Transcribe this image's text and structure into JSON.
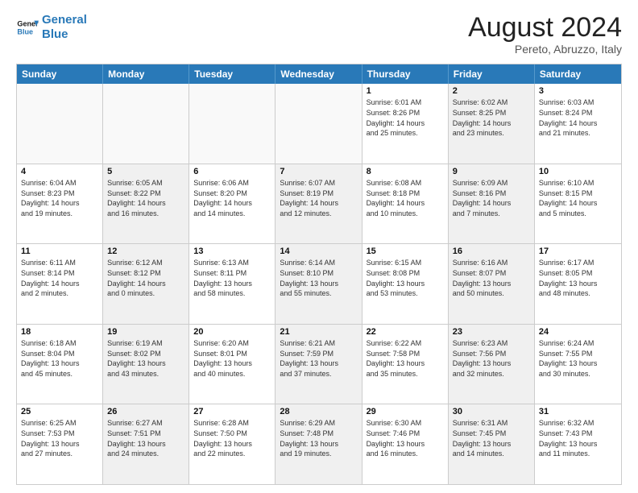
{
  "header": {
    "logo_line1": "General",
    "logo_line2": "Blue",
    "main_title": "August 2024",
    "subtitle": "Pereto, Abruzzo, Italy"
  },
  "days_of_week": [
    "Sunday",
    "Monday",
    "Tuesday",
    "Wednesday",
    "Thursday",
    "Friday",
    "Saturday"
  ],
  "weeks": [
    [
      {
        "day": "",
        "info": "",
        "empty": true
      },
      {
        "day": "",
        "info": "",
        "empty": true
      },
      {
        "day": "",
        "info": "",
        "empty": true
      },
      {
        "day": "",
        "info": "",
        "empty": true
      },
      {
        "day": "1",
        "info": "Sunrise: 6:01 AM\nSunset: 8:26 PM\nDaylight: 14 hours\nand 25 minutes.",
        "empty": false,
        "shaded": false
      },
      {
        "day": "2",
        "info": "Sunrise: 6:02 AM\nSunset: 8:25 PM\nDaylight: 14 hours\nand 23 minutes.",
        "empty": false,
        "shaded": true
      },
      {
        "day": "3",
        "info": "Sunrise: 6:03 AM\nSunset: 8:24 PM\nDaylight: 14 hours\nand 21 minutes.",
        "empty": false,
        "shaded": false
      }
    ],
    [
      {
        "day": "4",
        "info": "Sunrise: 6:04 AM\nSunset: 8:23 PM\nDaylight: 14 hours\nand 19 minutes.",
        "empty": false,
        "shaded": false
      },
      {
        "day": "5",
        "info": "Sunrise: 6:05 AM\nSunset: 8:22 PM\nDaylight: 14 hours\nand 16 minutes.",
        "empty": false,
        "shaded": true
      },
      {
        "day": "6",
        "info": "Sunrise: 6:06 AM\nSunset: 8:20 PM\nDaylight: 14 hours\nand 14 minutes.",
        "empty": false,
        "shaded": false
      },
      {
        "day": "7",
        "info": "Sunrise: 6:07 AM\nSunset: 8:19 PM\nDaylight: 14 hours\nand 12 minutes.",
        "empty": false,
        "shaded": true
      },
      {
        "day": "8",
        "info": "Sunrise: 6:08 AM\nSunset: 8:18 PM\nDaylight: 14 hours\nand 10 minutes.",
        "empty": false,
        "shaded": false
      },
      {
        "day": "9",
        "info": "Sunrise: 6:09 AM\nSunset: 8:16 PM\nDaylight: 14 hours\nand 7 minutes.",
        "empty": false,
        "shaded": true
      },
      {
        "day": "10",
        "info": "Sunrise: 6:10 AM\nSunset: 8:15 PM\nDaylight: 14 hours\nand 5 minutes.",
        "empty": false,
        "shaded": false
      }
    ],
    [
      {
        "day": "11",
        "info": "Sunrise: 6:11 AM\nSunset: 8:14 PM\nDaylight: 14 hours\nand 2 minutes.",
        "empty": false,
        "shaded": false
      },
      {
        "day": "12",
        "info": "Sunrise: 6:12 AM\nSunset: 8:12 PM\nDaylight: 14 hours\nand 0 minutes.",
        "empty": false,
        "shaded": true
      },
      {
        "day": "13",
        "info": "Sunrise: 6:13 AM\nSunset: 8:11 PM\nDaylight: 13 hours\nand 58 minutes.",
        "empty": false,
        "shaded": false
      },
      {
        "day": "14",
        "info": "Sunrise: 6:14 AM\nSunset: 8:10 PM\nDaylight: 13 hours\nand 55 minutes.",
        "empty": false,
        "shaded": true
      },
      {
        "day": "15",
        "info": "Sunrise: 6:15 AM\nSunset: 8:08 PM\nDaylight: 13 hours\nand 53 minutes.",
        "empty": false,
        "shaded": false
      },
      {
        "day": "16",
        "info": "Sunrise: 6:16 AM\nSunset: 8:07 PM\nDaylight: 13 hours\nand 50 minutes.",
        "empty": false,
        "shaded": true
      },
      {
        "day": "17",
        "info": "Sunrise: 6:17 AM\nSunset: 8:05 PM\nDaylight: 13 hours\nand 48 minutes.",
        "empty": false,
        "shaded": false
      }
    ],
    [
      {
        "day": "18",
        "info": "Sunrise: 6:18 AM\nSunset: 8:04 PM\nDaylight: 13 hours\nand 45 minutes.",
        "empty": false,
        "shaded": false
      },
      {
        "day": "19",
        "info": "Sunrise: 6:19 AM\nSunset: 8:02 PM\nDaylight: 13 hours\nand 43 minutes.",
        "empty": false,
        "shaded": true
      },
      {
        "day": "20",
        "info": "Sunrise: 6:20 AM\nSunset: 8:01 PM\nDaylight: 13 hours\nand 40 minutes.",
        "empty": false,
        "shaded": false
      },
      {
        "day": "21",
        "info": "Sunrise: 6:21 AM\nSunset: 7:59 PM\nDaylight: 13 hours\nand 37 minutes.",
        "empty": false,
        "shaded": true
      },
      {
        "day": "22",
        "info": "Sunrise: 6:22 AM\nSunset: 7:58 PM\nDaylight: 13 hours\nand 35 minutes.",
        "empty": false,
        "shaded": false
      },
      {
        "day": "23",
        "info": "Sunrise: 6:23 AM\nSunset: 7:56 PM\nDaylight: 13 hours\nand 32 minutes.",
        "empty": false,
        "shaded": true
      },
      {
        "day": "24",
        "info": "Sunrise: 6:24 AM\nSunset: 7:55 PM\nDaylight: 13 hours\nand 30 minutes.",
        "empty": false,
        "shaded": false
      }
    ],
    [
      {
        "day": "25",
        "info": "Sunrise: 6:25 AM\nSunset: 7:53 PM\nDaylight: 13 hours\nand 27 minutes.",
        "empty": false,
        "shaded": false
      },
      {
        "day": "26",
        "info": "Sunrise: 6:27 AM\nSunset: 7:51 PM\nDaylight: 13 hours\nand 24 minutes.",
        "empty": false,
        "shaded": true
      },
      {
        "day": "27",
        "info": "Sunrise: 6:28 AM\nSunset: 7:50 PM\nDaylight: 13 hours\nand 22 minutes.",
        "empty": false,
        "shaded": false
      },
      {
        "day": "28",
        "info": "Sunrise: 6:29 AM\nSunset: 7:48 PM\nDaylight: 13 hours\nand 19 minutes.",
        "empty": false,
        "shaded": true
      },
      {
        "day": "29",
        "info": "Sunrise: 6:30 AM\nSunset: 7:46 PM\nDaylight: 13 hours\nand 16 minutes.",
        "empty": false,
        "shaded": false
      },
      {
        "day": "30",
        "info": "Sunrise: 6:31 AM\nSunset: 7:45 PM\nDaylight: 13 hours\nand 14 minutes.",
        "empty": false,
        "shaded": true
      },
      {
        "day": "31",
        "info": "Sunrise: 6:32 AM\nSunset: 7:43 PM\nDaylight: 13 hours\nand 11 minutes.",
        "empty": false,
        "shaded": false
      }
    ]
  ]
}
